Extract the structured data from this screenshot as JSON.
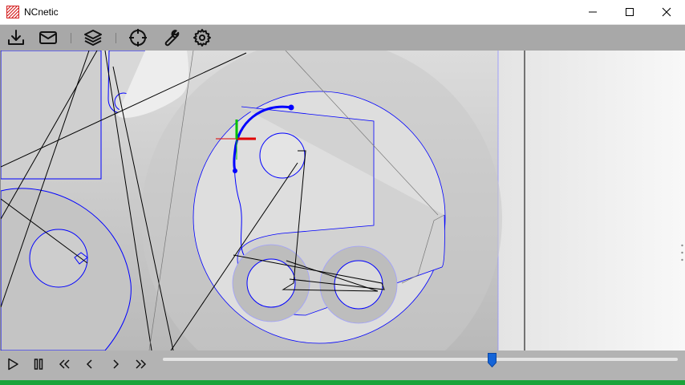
{
  "window": {
    "title": "NCnetic",
    "controls": [
      "minimize",
      "maximize",
      "close"
    ]
  },
  "toolbar": {
    "buttons": [
      {
        "name": "download",
        "icon": "download-icon"
      },
      {
        "name": "mail",
        "icon": "mail-icon"
      },
      {
        "name": "layers",
        "icon": "layers-icon"
      },
      {
        "name": "crosshair",
        "icon": "crosshair-icon"
      },
      {
        "name": "wrench",
        "icon": "wrench-icon"
      },
      {
        "name": "settings",
        "icon": "gear-icon"
      }
    ]
  },
  "viewport": {
    "description_icons": [
      "toolpath",
      "axis-gizmo"
    ]
  },
  "playback": {
    "buttons": [
      {
        "name": "play",
        "icon": "play-icon"
      },
      {
        "name": "pause",
        "icon": "pause-icon"
      },
      {
        "name": "rewind",
        "icon": "double-chevron-left-icon"
      },
      {
        "name": "step-back",
        "icon": "chevron-left-icon"
      },
      {
        "name": "step-forward",
        "icon": "chevron-right-icon"
      },
      {
        "name": "fast-forward",
        "icon": "double-chevron-right-icon"
      }
    ],
    "progress_fraction": 0.64
  },
  "colors": {
    "toolbar_bg": "#a8a8a8",
    "viewport_bg": "#c3c3c3",
    "toolpath_blue": "#0000ff",
    "status_green": "#1aa33a"
  }
}
